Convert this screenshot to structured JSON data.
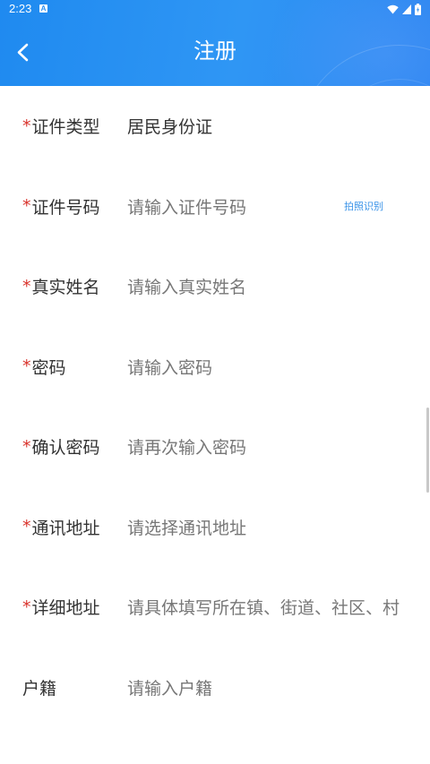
{
  "status_bar": {
    "time": "2:23",
    "notification_badge": "A",
    "icons": [
      "wifi-icon",
      "signal-icon",
      "battery-icon"
    ]
  },
  "header": {
    "title": "注册",
    "back_icon": "chevron-left-icon",
    "gradient_colors": [
      "#1f8af0",
      "#2d86f1"
    ]
  },
  "form": {
    "required_mark": "*",
    "fields": [
      {
        "label": "证件类型",
        "value": "居民身份证",
        "required": true
      },
      {
        "label": "证件号码",
        "placeholder": "请输入证件号码",
        "required": true,
        "action_link": "拍照识别"
      },
      {
        "label": "真实姓名",
        "placeholder": "请输入真实姓名",
        "required": true
      },
      {
        "label": "密码",
        "placeholder": "请输入密码",
        "required": true
      },
      {
        "label": "确认密码",
        "placeholder": "请再次输入密码",
        "required": true
      },
      {
        "label": "通讯地址",
        "placeholder": "请选择通讯地址",
        "required": true
      },
      {
        "label": "详细地址",
        "placeholder": "请具体填写所在镇、街道、社区、村",
        "required": true
      },
      {
        "label": "户籍",
        "placeholder": "请输入户籍",
        "required": false
      }
    ]
  },
  "colors": {
    "required_mark": "#d9322b",
    "link": "#3a93e8",
    "label": "#333333",
    "placeholder": "#777777"
  }
}
